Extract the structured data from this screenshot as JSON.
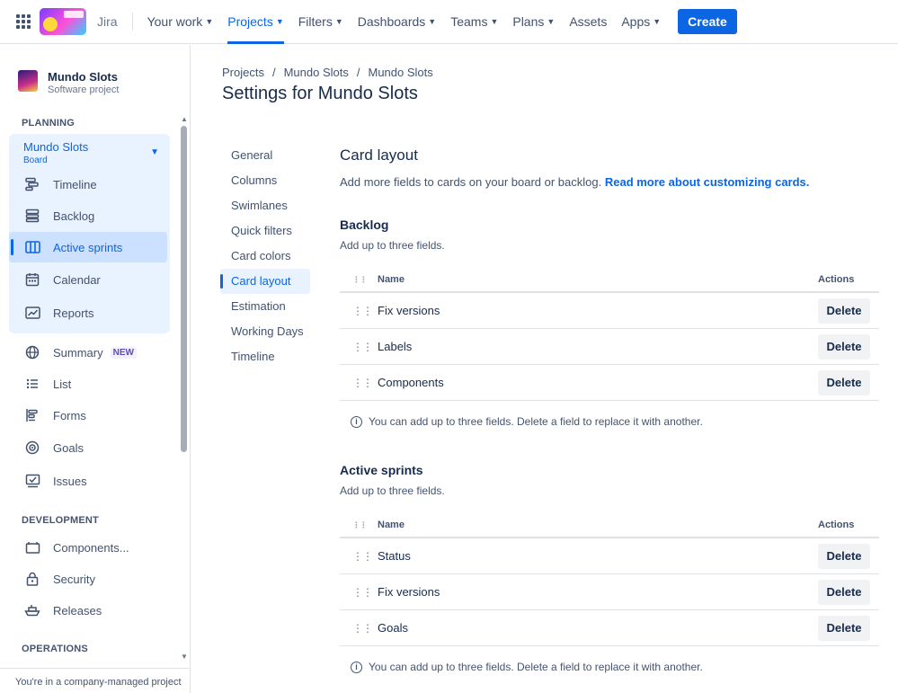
{
  "topnav": {
    "product": "Jira",
    "items": [
      {
        "label": "Your work",
        "chevron": true
      },
      {
        "label": "Projects",
        "chevron": true,
        "active": true
      },
      {
        "label": "Filters",
        "chevron": true
      },
      {
        "label": "Dashboards",
        "chevron": true
      },
      {
        "label": "Teams",
        "chevron": true
      },
      {
        "label": "Plans",
        "chevron": true
      },
      {
        "label": "Assets",
        "chevron": false
      },
      {
        "label": "Apps",
        "chevron": true
      }
    ],
    "create_label": "Create",
    "accent": "#0c66e4"
  },
  "sidebar": {
    "project_name": "Mundo Slots",
    "project_type": "Software project",
    "planning_label": "PLANNING",
    "board_title": "Mundo Slots",
    "board_sub": "Board",
    "board_items": [
      {
        "label": "Timeline",
        "icon": "timeline-icon"
      },
      {
        "label": "Backlog",
        "icon": "backlog-icon"
      },
      {
        "label": "Active sprints",
        "icon": "board-columns-icon",
        "active": true
      },
      {
        "label": "Calendar",
        "icon": "calendar-icon"
      },
      {
        "label": "Reports",
        "icon": "reports-icon"
      }
    ],
    "other_items": [
      {
        "label": "Summary",
        "icon": "globe-icon",
        "badge": "NEW"
      },
      {
        "label": "List",
        "icon": "list-icon"
      },
      {
        "label": "Forms",
        "icon": "forms-icon"
      },
      {
        "label": "Goals",
        "icon": "goals-icon"
      },
      {
        "label": "Issues",
        "icon": "issues-icon"
      }
    ],
    "development_label": "DEVELOPMENT",
    "dev_items": [
      {
        "label": "Components...",
        "icon": "components-icon"
      },
      {
        "label": "Security",
        "icon": "lock-icon"
      },
      {
        "label": "Releases",
        "icon": "ship-icon"
      }
    ],
    "operations_label": "OPERATIONS",
    "footer": "You're in a company-managed project"
  },
  "breadcrumb": [
    "Projects",
    "Mundo Slots",
    "Mundo Slots"
  ],
  "page_title": "Settings for Mundo Slots",
  "subnav": [
    {
      "label": "General"
    },
    {
      "label": "Columns"
    },
    {
      "label": "Swimlanes"
    },
    {
      "label": "Quick filters"
    },
    {
      "label": "Card colors"
    },
    {
      "label": "Card layout",
      "active": true
    },
    {
      "label": "Estimation"
    },
    {
      "label": "Working Days"
    },
    {
      "label": "Timeline"
    }
  ],
  "card_layout": {
    "title": "Card layout",
    "desc": "Add more fields to cards on your board or backlog.",
    "link": "Read more about customizing cards.",
    "name_header": "Name",
    "actions_header": "Actions",
    "delete_label": "Delete",
    "info": "You can add up to three fields. Delete a field to replace it with another.",
    "sections": [
      {
        "title": "Backlog",
        "sub": "Add up to three fields.",
        "rows": [
          "Fix versions",
          "Labels",
          "Components"
        ]
      },
      {
        "title": "Active sprints",
        "sub": "Add up to three fields.",
        "rows": [
          "Status",
          "Fix versions",
          "Goals"
        ]
      }
    ]
  }
}
